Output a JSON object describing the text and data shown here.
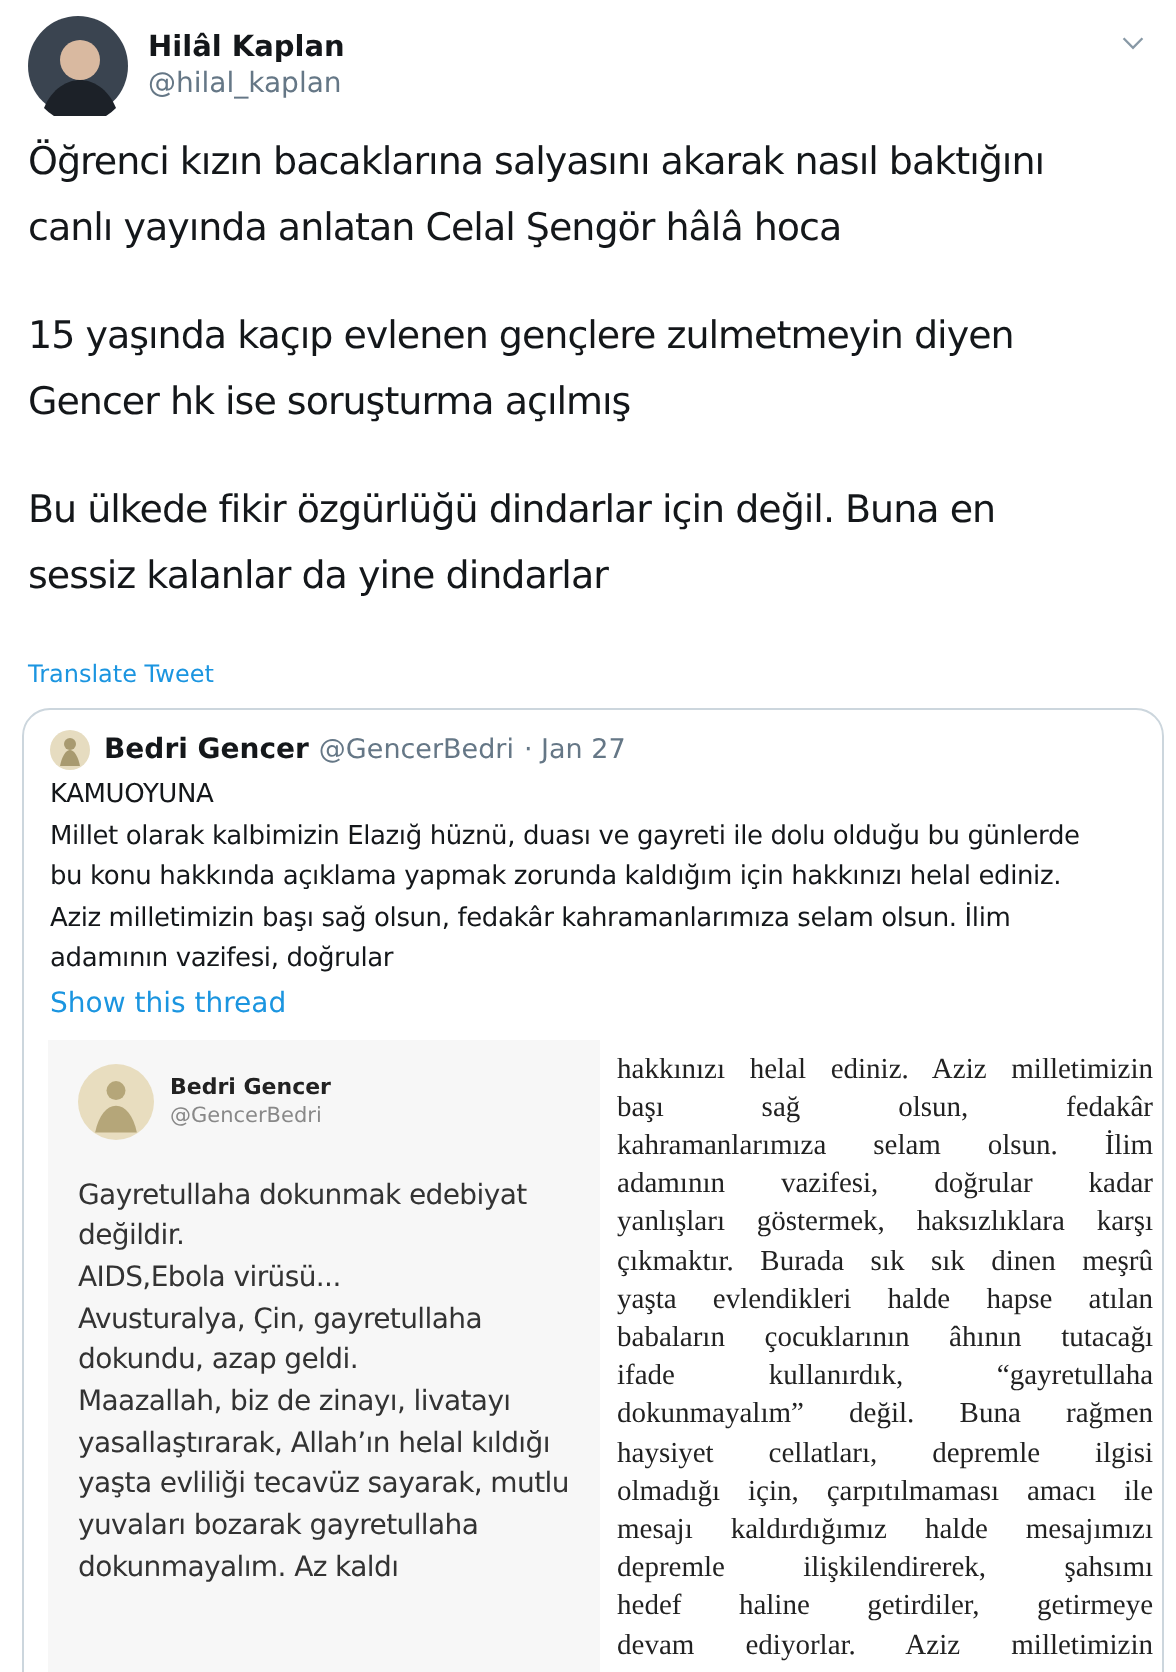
{
  "tweet": {
    "author": {
      "name": "Hilâl Kaplan",
      "handle": "@hilal_kaplan"
    },
    "paragraphs": [
      [
        "Öğrenci kızın bacaklarına salyasını akarak nasıl baktığını",
        "canlı yayında anlatan Celal Şengör hâlâ hoca"
      ],
      [
        "15 yaşında kaçıp evlenen gençlere zulmetmeyin diyen",
        "Gencer hk ise soruşturma açılmış"
      ],
      [
        "Bu ülkede fikir özgürlüğü dindarlar için değil. Buna en",
        "sessiz kalanlar da yine dindarlar"
      ]
    ],
    "translate_link": "Translate Tweet",
    "quoted": {
      "name": "Bedri Gencer",
      "handle": "@GencerBedri",
      "date": "· Jan 27",
      "lines": [
        "KAMUOYUNA",
        "Millet olarak kalbimizin Elazığ hüznü, duası ve gayreti ile dolu olduğu bu günlerde",
        "bu konu hakkında açıklama yapmak zorunda kaldığım için hakkınızı helal ediniz.",
        "Aziz milletimizin başı sağ olsun, fedakâr kahramanlarımıza selam olsun. İlim",
        "adamının vazifesi, doğrular"
      ],
      "thread_link": "Show this thread",
      "image_1": {
        "name": "Bedri Gencer",
        "handle": "@GencerBedri",
        "lines": [
          "Gayretullaha dokunmak edebiyat",
          "değildir.",
          "AIDS,Ebola virüsü...",
          "Avusturalya, Çin, gayretullaha",
          "dokundu, azap geldi.",
          "Maazallah, biz de zinayı, livatayı",
          "yasallaştırarak, Allah’ın helal kıldığı",
          "yaşta evliliği tecavüz sayarak, mutlu",
          "yuvaları bozarak gayretullaha",
          "dokunmayalım. Az kaldı"
        ]
      },
      "image_2": {
        "lines": [
          "hakkınızı helal ediniz. Aziz milletimizin",
          "başı sağ olsun, fedakâr",
          "kahramanlarımıza selam olsun. İlim",
          "adamının vazifesi, doğrular kadar",
          "yanlışları göstermek, haksızlıklara karşı",
          "çıkmaktır. Burada sık sık dinen meşrû",
          "yaşta evlendikleri halde hapse atılan",
          "babaların çocuklarının âhının tutacağı",
          "ifade kullanırdık, “gayretullaha",
          "dokunmayalım” değil. Buna rağmen",
          "haysiyet cellatları, depremle ilgisi",
          "olmadığı için, çarpıtılmaması amacı ile",
          "mesajı kaldırdığımız halde mesajımızı",
          "depremle ilişkilendirerek, şahsımı",
          "hedef haline getirdiler, getirmeye",
          "devam ediyorlar. Aziz milletimizin"
        ]
      }
    }
  }
}
